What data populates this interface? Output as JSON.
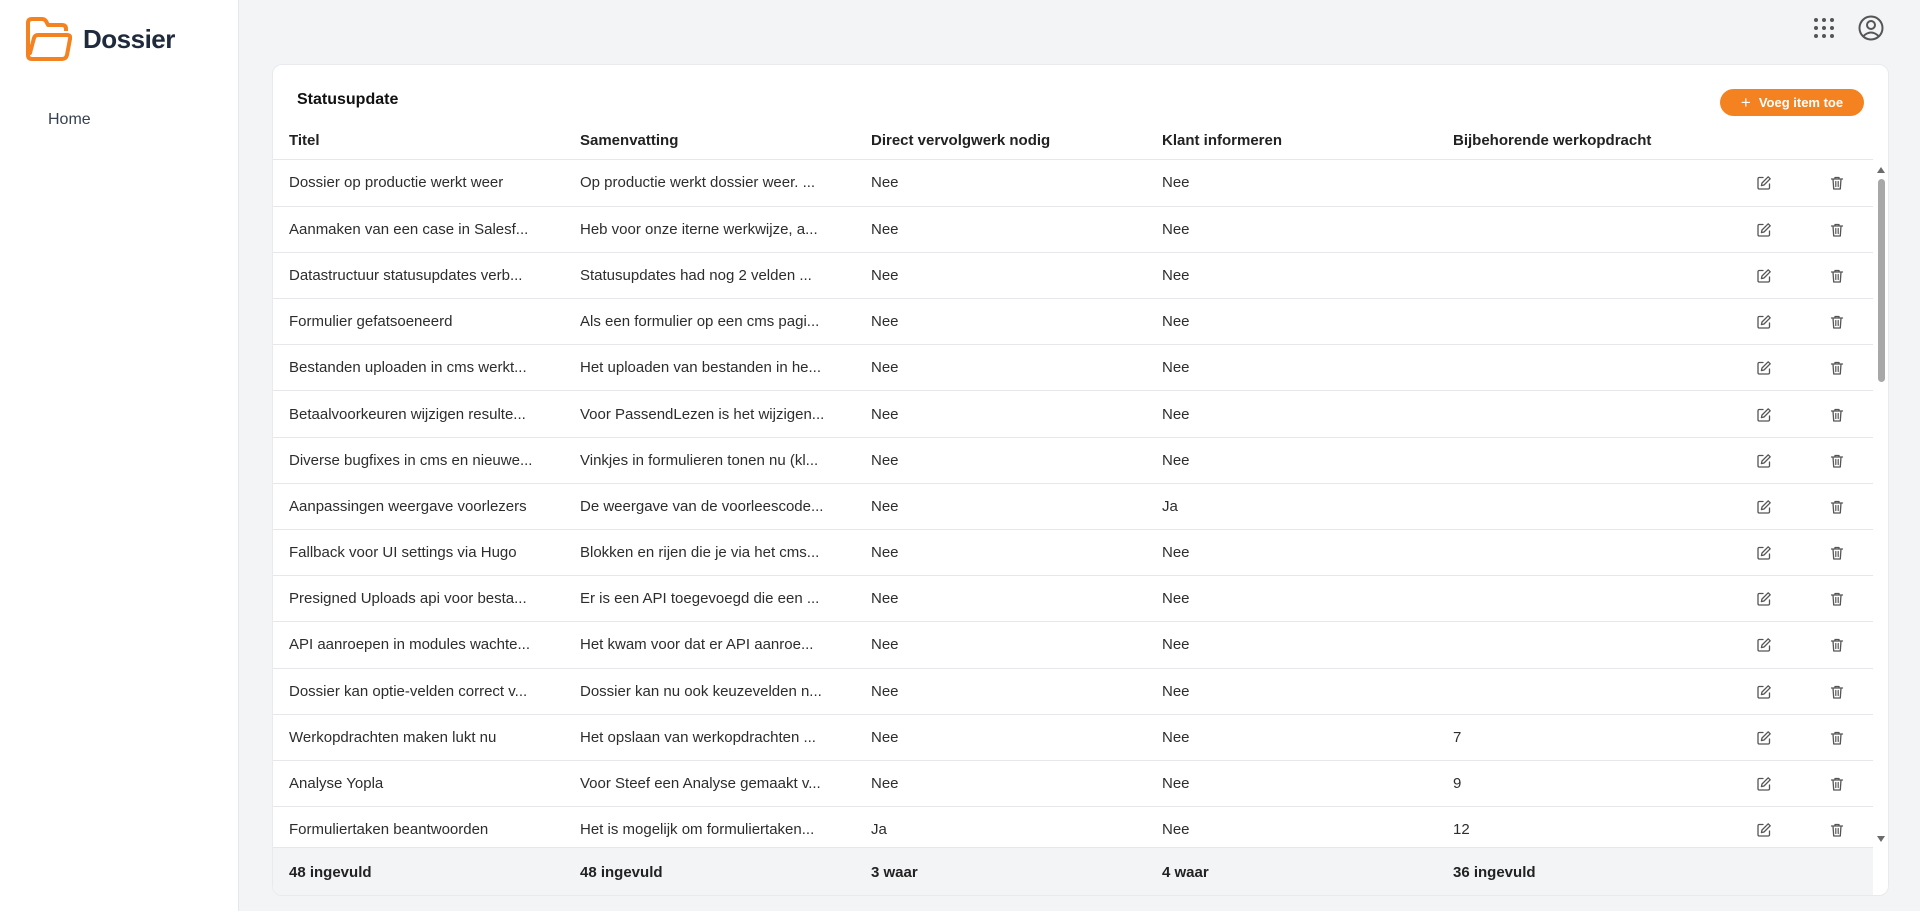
{
  "app": {
    "name": "Dossier",
    "accent_color": "#f58220",
    "logo_icon": "folder-icon"
  },
  "sidebar": {
    "items": [
      {
        "label": "Home"
      }
    ]
  },
  "topbar": {
    "icons": [
      "apps-grid-icon",
      "account-circle-icon"
    ]
  },
  "card": {
    "title": "Statusupdate",
    "add_button_label": "Voeg item toe"
  },
  "table": {
    "columns": [
      "Titel",
      "Samenvatting",
      "Direct vervolgwerk nodig",
      "Klant informeren",
      "Bijbehorende werkopdracht"
    ],
    "rows": [
      {
        "titel": "Dossier op productie werkt weer",
        "samenvatting": "Op productie werkt dossier weer. ...",
        "vervolgwerk": "Nee",
        "klant": "Nee",
        "werkopdracht": ""
      },
      {
        "titel": "Aanmaken van een case in Salesf...",
        "samenvatting": "Heb voor onze iterne werkwijze, a...",
        "vervolgwerk": "Nee",
        "klant": "Nee",
        "werkopdracht": ""
      },
      {
        "titel": "Datastructuur statusupdates verb...",
        "samenvatting": "Statusupdates had nog 2 velden ...",
        "vervolgwerk": "Nee",
        "klant": "Nee",
        "werkopdracht": ""
      },
      {
        "titel": "Formulier gefatsoeneerd",
        "samenvatting": "Als een formulier op een cms pagi...",
        "vervolgwerk": "Nee",
        "klant": "Nee",
        "werkopdracht": ""
      },
      {
        "titel": "Bestanden uploaden in cms werkt...",
        "samenvatting": "Het uploaden van bestanden in he...",
        "vervolgwerk": "Nee",
        "klant": "Nee",
        "werkopdracht": ""
      },
      {
        "titel": "Betaalvoorkeuren wijzigen resulte...",
        "samenvatting": "Voor PassendLezen is het wijzigen...",
        "vervolgwerk": "Nee",
        "klant": "Nee",
        "werkopdracht": ""
      },
      {
        "titel": "Diverse bugfixes in cms en nieuwe...",
        "samenvatting": "Vinkjes in formulieren tonen nu (kl...",
        "vervolgwerk": "Nee",
        "klant": "Nee",
        "werkopdracht": ""
      },
      {
        "titel": "Aanpassingen weergave voorlezers",
        "samenvatting": "De weergave van de voorleescode...",
        "vervolgwerk": "Nee",
        "klant": "Ja",
        "werkopdracht": ""
      },
      {
        "titel": "Fallback voor UI settings via Hugo",
        "samenvatting": "Blokken en rijen die je via het cms...",
        "vervolgwerk": "Nee",
        "klant": "Nee",
        "werkopdracht": ""
      },
      {
        "titel": "Presigned Uploads api voor besta...",
        "samenvatting": "Er is een API toegevoegd die een ...",
        "vervolgwerk": "Nee",
        "klant": "Nee",
        "werkopdracht": ""
      },
      {
        "titel": "API aanroepen in modules wachte...",
        "samenvatting": "Het kwam voor dat er API aanroe...",
        "vervolgwerk": "Nee",
        "klant": "Nee",
        "werkopdracht": ""
      },
      {
        "titel": "Dossier kan optie-velden correct v...",
        "samenvatting": "Dossier kan nu ook keuzevelden n...",
        "vervolgwerk": "Nee",
        "klant": "Nee",
        "werkopdracht": ""
      },
      {
        "titel": "Werkopdrachten maken lukt nu",
        "samenvatting": "Het opslaan van werkopdrachten ...",
        "vervolgwerk": "Nee",
        "klant": "Nee",
        "werkopdracht": "7"
      },
      {
        "titel": "Analyse Yopla",
        "samenvatting": "Voor Steef een Analyse gemaakt v...",
        "vervolgwerk": "Nee",
        "klant": "Nee",
        "werkopdracht": "9"
      },
      {
        "titel": "Formuliertaken beantwoorden",
        "samenvatting": "Het is mogelijk om formuliertaken...",
        "vervolgwerk": "Ja",
        "klant": "Nee",
        "werkopdracht": "12"
      }
    ],
    "footer": [
      "48 ingevuld",
      "48 ingevuld",
      "3 waar",
      "4 waar",
      "36 ingevuld"
    ]
  }
}
